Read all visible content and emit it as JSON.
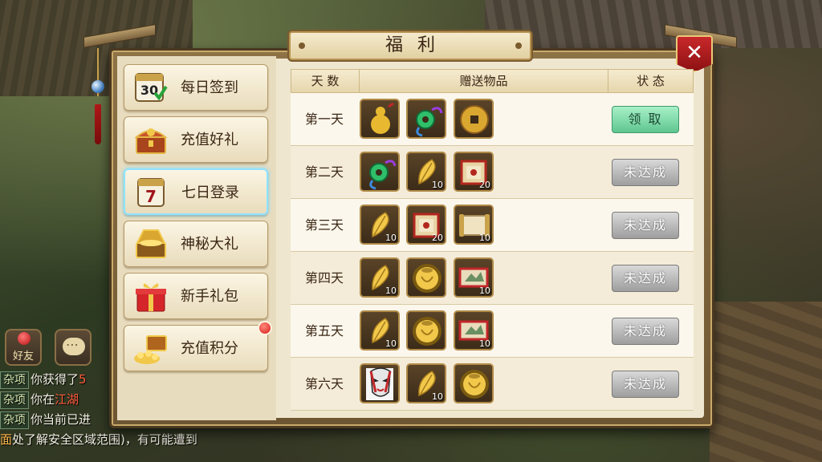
{
  "dialog": {
    "title": "福利",
    "close_glyph": "✕"
  },
  "menu": [
    {
      "label": "每日签到",
      "icon": "calendar-30-icon",
      "badge": "30",
      "active": false
    },
    {
      "label": "充值好礼",
      "icon": "treasure-chest-icon",
      "active": false
    },
    {
      "label": "七日登录",
      "icon": "calendar-7-icon",
      "badge": "7",
      "active": true
    },
    {
      "label": "神秘大礼",
      "icon": "gold-chest-icon",
      "active": false
    },
    {
      "label": "新手礼包",
      "icon": "gift-box-icon",
      "active": false
    },
    {
      "label": "充值积分",
      "icon": "gold-pile-icon",
      "active": false,
      "notify": true
    }
  ],
  "table": {
    "headers": {
      "day": "天 数",
      "items": "赠送物品",
      "status": "状 态"
    },
    "rows": [
      {
        "day": "第一天",
        "items": [
          {
            "icon": "gourd-pendant-icon",
            "count": ""
          },
          {
            "icon": "jade-pendant-icon",
            "count": ""
          },
          {
            "icon": "copper-coin-icon",
            "count": ""
          }
        ],
        "status": "领 取",
        "claimable": true
      },
      {
        "day": "第二天",
        "items": [
          {
            "icon": "jade-pendant-icon",
            "count": ""
          },
          {
            "icon": "gold-feather-icon",
            "count": "10"
          },
          {
            "icon": "red-scroll-icon",
            "count": "20"
          }
        ],
        "status": "未达成",
        "claimable": false
      },
      {
        "day": "第三天",
        "items": [
          {
            "icon": "gold-feather-icon",
            "count": "10"
          },
          {
            "icon": "red-scroll-icon",
            "count": "20"
          },
          {
            "icon": "paper-scroll-icon",
            "count": "10"
          }
        ],
        "status": "未达成",
        "claimable": false
      },
      {
        "day": "第四天",
        "items": [
          {
            "icon": "gold-feather-icon",
            "count": "10"
          },
          {
            "icon": "gold-jar-icon",
            "count": ""
          },
          {
            "icon": "painting-scroll-icon",
            "count": "10"
          }
        ],
        "status": "未达成",
        "claimable": false
      },
      {
        "day": "第五天",
        "items": [
          {
            "icon": "gold-feather-icon",
            "count": "10"
          },
          {
            "icon": "gold-jar-icon",
            "count": ""
          },
          {
            "icon": "painting-scroll-icon",
            "count": "10"
          }
        ],
        "status": "未达成",
        "claimable": false
      },
      {
        "day": "第六天",
        "items": [
          {
            "icon": "opera-mask-icon",
            "count": ""
          },
          {
            "icon": "gold-feather-icon",
            "count": "10"
          },
          {
            "icon": "gold-jar-icon",
            "count": ""
          }
        ],
        "status": "未达成",
        "claimable": false
      }
    ]
  },
  "hud": {
    "friends_label": "好友"
  },
  "chat": [
    {
      "tag": "杂项",
      "text": "你获得了",
      "highlight": "5"
    },
    {
      "tag": "杂项",
      "text": "你在",
      "highlight": "江湖"
    },
    {
      "tag": "杂项",
      "text": "你当前已进",
      "highlight": ""
    },
    {
      "tag": "",
      "prefix": "面",
      "text": "处了解安全区域范围)，有可能遭到",
      "highlight": ""
    }
  ],
  "colors": {
    "claim_green": "#5fc690",
    "locked_gray": "#9e9e9e",
    "frame_brown": "#6e5632",
    "parchment": "#efe6cf",
    "close_red": "#c8282a"
  }
}
